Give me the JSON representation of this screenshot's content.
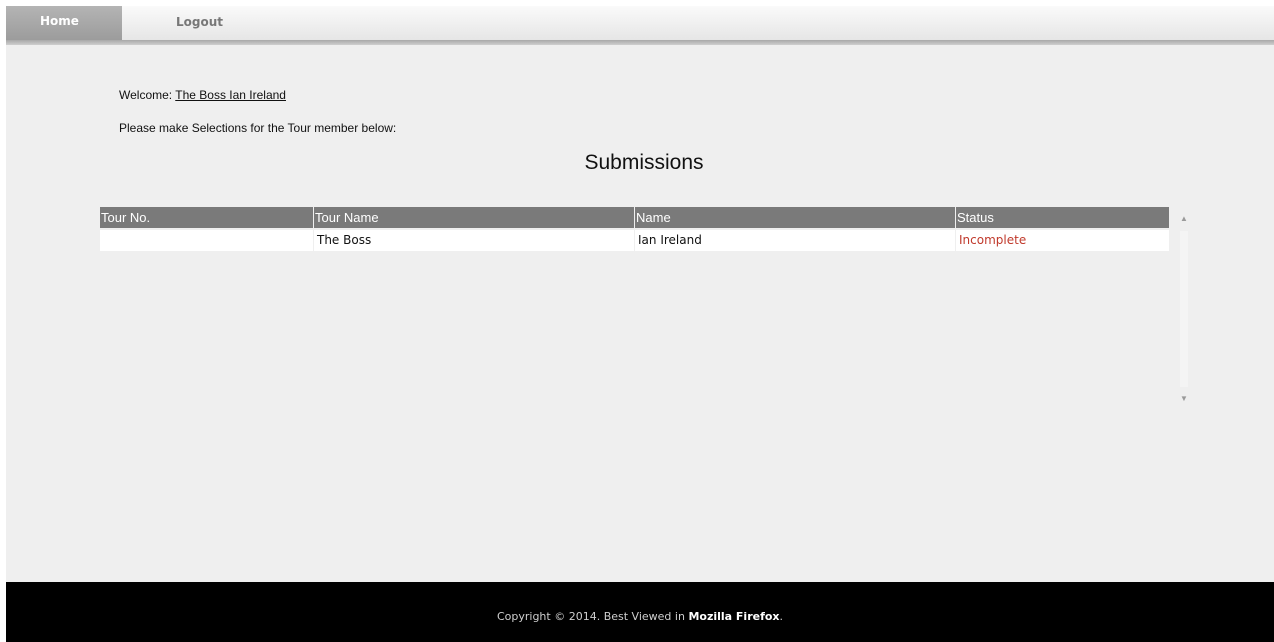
{
  "nav": {
    "tabs": [
      {
        "label": "Home",
        "active": true
      },
      {
        "label": "Logout",
        "active": false
      }
    ]
  },
  "welcome": {
    "prefix": "Welcome: ",
    "user_link": "The Boss Ian Ireland"
  },
  "instruction": "Please make Selections for the Tour member below:",
  "section_title": "Submissions",
  "table": {
    "columns": [
      "Tour No.",
      "Tour Name",
      "Name",
      "Status"
    ],
    "rows": [
      {
        "tour_no": "",
        "tour_name": "The Boss",
        "name": "Ian Ireland",
        "status": "Incomplete"
      }
    ]
  },
  "scrollbar": {
    "up_icon": "scroll-up-arrow-icon",
    "down_icon": "scroll-down-arrow-icon"
  },
  "footer": {
    "prefix": "Copyright © 2014. Best Viewed in ",
    "brand": "Mozilla Firefox",
    "suffix": "."
  },
  "colors": {
    "header_bg": "#7a7a7a",
    "status_incomplete": "#c0392b",
    "footer_bg": "#000000",
    "page_bg": "#efefef"
  }
}
